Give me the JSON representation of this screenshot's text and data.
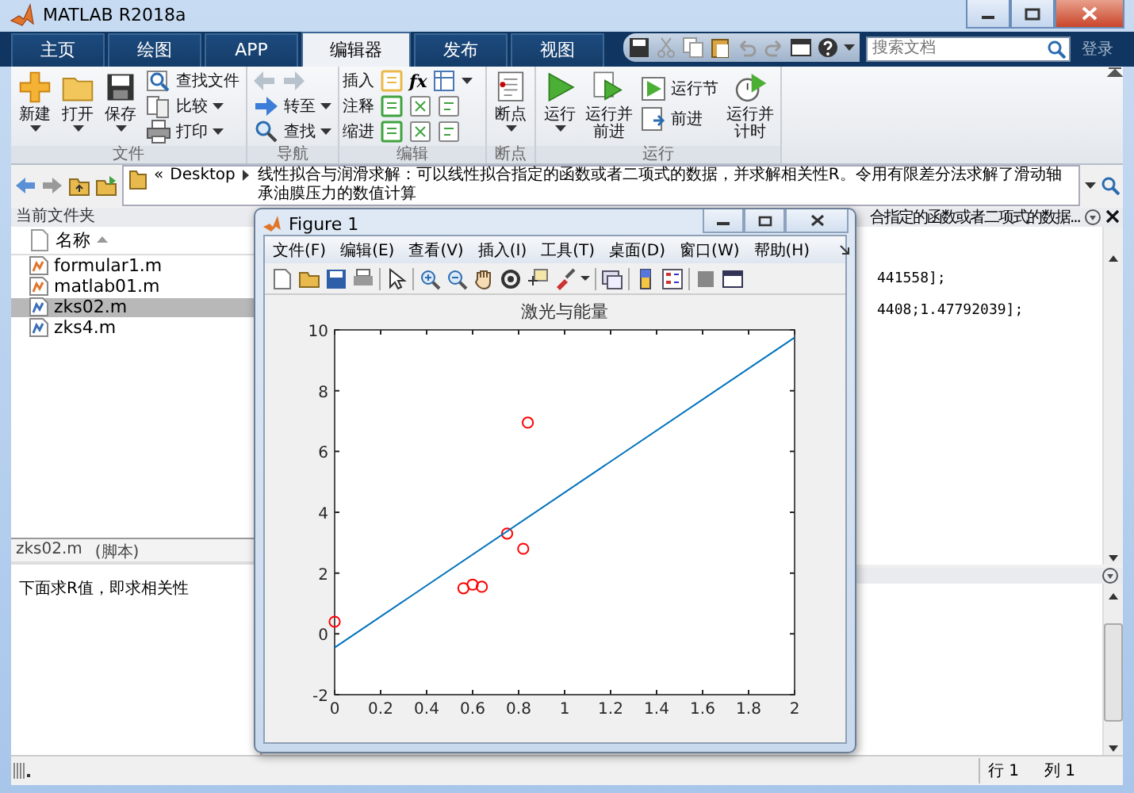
{
  "window": {
    "title": "MATLAB R2018a"
  },
  "tabs": [
    {
      "label": "主页",
      "selected": false
    },
    {
      "label": "绘图",
      "selected": false
    },
    {
      "label": "APP",
      "selected": false
    },
    {
      "label": "编辑器",
      "selected": true
    },
    {
      "label": "发布",
      "selected": false
    },
    {
      "label": "视图",
      "selected": false
    }
  ],
  "search": {
    "placeholder": "搜索文档"
  },
  "login": "登录",
  "ribbon": {
    "file": {
      "label": "文件",
      "large": [
        {
          "label": "新建",
          "menu": true
        },
        {
          "label": "打开",
          "menu": true
        },
        {
          "label": "保存",
          "menu": true
        }
      ],
      "small": [
        {
          "label": "查找文件",
          "menu": false
        },
        {
          "label": "比较",
          "menu": true
        },
        {
          "label": "打印",
          "menu": true
        }
      ]
    },
    "navigate": {
      "label": "导航",
      "arrows": [
        {
          "disabled": true
        },
        {
          "disabled": true
        }
      ],
      "small": [
        {
          "label": "转至",
          "menu": true
        },
        {
          "label": "查找",
          "menu": true
        }
      ]
    },
    "edit": {
      "label": "编辑",
      "rows": [
        {
          "label": "插入"
        },
        {
          "label": "注释"
        },
        {
          "label": "缩进"
        }
      ],
      "function_label": "fx"
    },
    "breakpoints": {
      "label": "断点",
      "large": [
        {
          "label": "断点",
          "menu": true
        }
      ]
    },
    "run": {
      "label": "运行",
      "large": [
        {
          "label": "运行",
          "menu": true
        },
        {
          "label": "运行并前进",
          "menu": false
        }
      ],
      "small": [
        {
          "label": "运行节"
        },
        {
          "label": "前进"
        }
      ],
      "large_after": [
        {
          "label": "运行并计时",
          "menu": false
        }
      ]
    }
  },
  "address": {
    "overflow_mark": "«",
    "path": [
      "Desktop",
      "线性拟合与润滑求解：可以线性拟合指定的函数或者二项式的数据，并求解相关性R。令用有限差分法求解了滑动轴承油膜压力的数值计算"
    ]
  },
  "current_folder": {
    "title": "当前文件夹",
    "column": "名称",
    "files": [
      {
        "name": "formular1.m",
        "kind": "function",
        "selected": false
      },
      {
        "name": "matlab01.m",
        "kind": "function",
        "selected": false
      },
      {
        "name": "zks02.m",
        "kind": "script",
        "selected": true
      },
      {
        "name": "zks4.m",
        "kind": "script",
        "selected": false
      }
    ]
  },
  "details": {
    "file": "zks02.m",
    "type": "(脚本)",
    "text": "下面求R值，即求相关性"
  },
  "editor": {
    "tab_title": "合指定的函数或者二项式的数据...",
    "lines": [
      "441558];",
      "4408;1.47792039];"
    ]
  },
  "figure": {
    "title": "Figure 1",
    "menus": [
      "文件(F)",
      "编辑(E)",
      "查看(V)",
      "插入(I)",
      "工具(T)",
      "桌面(D)",
      "窗口(W)",
      "帮助(H)"
    ],
    "chart_data": {
      "type": "scatter",
      "title": "激光与能量",
      "xlim": [
        0,
        2
      ],
      "ylim": [
        -2,
        10
      ],
      "xticks": [
        0,
        0.2,
        0.4,
        0.6,
        0.8,
        1,
        1.2,
        1.4,
        1.6,
        1.8,
        2
      ],
      "yticks": [
        -2,
        0,
        2,
        4,
        6,
        8,
        10
      ],
      "series": [
        {
          "type": "scatter",
          "color": "#ff0000",
          "x": [
            0,
            0.56,
            0.6,
            0.64,
            0.75,
            0.82,
            0.84
          ],
          "values": [
            0.4,
            1.5,
            1.62,
            1.55,
            3.3,
            2.8,
            6.95
          ]
        },
        {
          "type": "line",
          "color": "#0072bd",
          "x": [
            0,
            2
          ],
          "values": [
            -0.45,
            9.75
          ]
        }
      ]
    }
  },
  "status_bar": {
    "row": "行 1",
    "column": "列 1"
  }
}
